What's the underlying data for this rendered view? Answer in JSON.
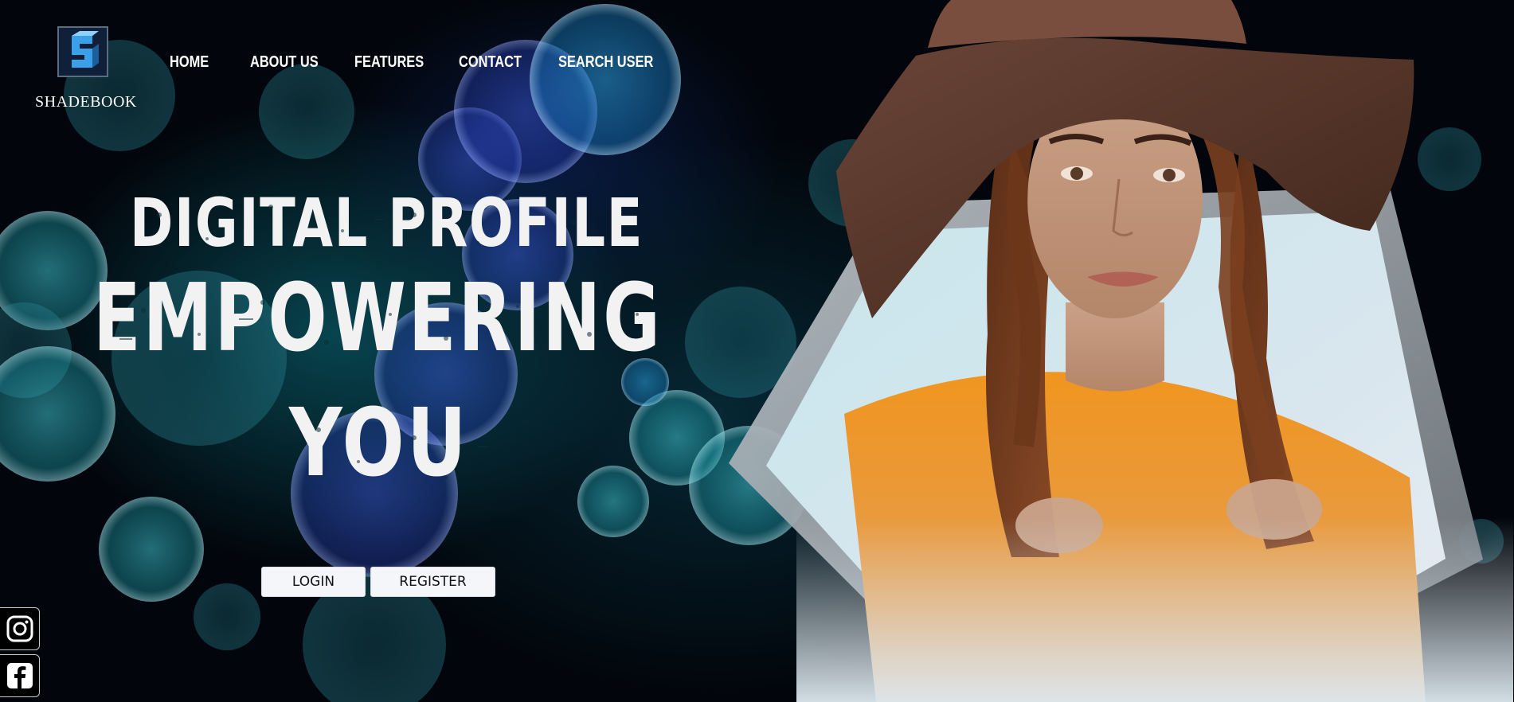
{
  "brand": {
    "name": "SHADEBOOK",
    "logo_icon": "s-logo-icon"
  },
  "nav": {
    "items": [
      {
        "label": "HOME"
      },
      {
        "label": "ABOUT US"
      },
      {
        "label": "FEATURES"
      },
      {
        "label": "CONTACT"
      },
      {
        "label": "SEARCH USER"
      }
    ]
  },
  "hero": {
    "line1": "DIGITAL PROFILE",
    "line2": "EMPOWERING",
    "line3": "YOU",
    "image": "woman-in-hat-portrait"
  },
  "actions": {
    "login_label": "LOGIN",
    "register_label": "REGISTER"
  },
  "social": {
    "items": [
      {
        "icon": "instagram-icon"
      },
      {
        "icon": "facebook-icon"
      }
    ]
  },
  "colors": {
    "background": "#02060c",
    "accent_teal": "#1fa6b8",
    "logo_blue": "#3aa0e8",
    "button_bg": "#f4f6f9",
    "text": "#ffffff"
  }
}
